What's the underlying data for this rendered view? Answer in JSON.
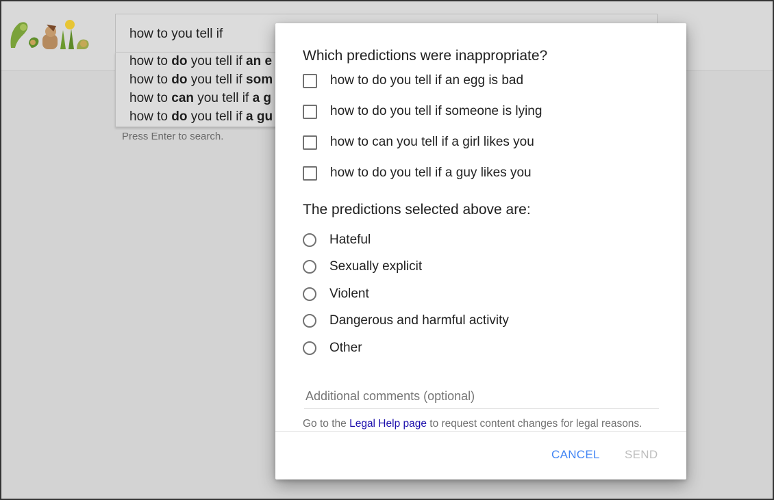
{
  "search": {
    "query": "how to you tell if",
    "press_enter_hint": "Press Enter to search.",
    "suggestions": [
      {
        "pre": "how to ",
        "bold1": "do",
        "mid": " you tell if ",
        "bold2": "an e"
      },
      {
        "pre": "how to ",
        "bold1": "do",
        "mid": " you tell if ",
        "bold2": "som"
      },
      {
        "pre": "how to ",
        "bold1": "can",
        "mid": " you tell if ",
        "bold2": "a g"
      },
      {
        "pre": "how to ",
        "bold1": "do",
        "mid": " you tell if ",
        "bold2": "a gu"
      }
    ]
  },
  "dialog": {
    "question": "Which predictions were inappropriate?",
    "predictions": [
      {
        "label": "how to do you tell if an egg is bad",
        "checked": false
      },
      {
        "label": "how to do you tell if someone is lying",
        "checked": false
      },
      {
        "label": "how to can you tell if a girl likes you",
        "checked": false
      },
      {
        "label": "how to do you tell if a guy likes you",
        "checked": false
      }
    ],
    "category_title": "The predictions selected above are:",
    "categories": [
      {
        "label": "Hateful",
        "selected": false
      },
      {
        "label": "Sexually explicit",
        "selected": false
      },
      {
        "label": "Violent",
        "selected": false
      },
      {
        "label": "Dangerous and harmful activity",
        "selected": false
      },
      {
        "label": "Other",
        "selected": false
      }
    ],
    "comments_placeholder": "Additional comments (optional)",
    "legal": {
      "prefix": "Go to the ",
      "link_text": "Legal Help page",
      "suffix": " to request content changes for legal reasons."
    },
    "cancel_label": "CANCEL",
    "send_label": "SEND"
  },
  "colors": {
    "accent": "#4285f4",
    "link": "#1a0dab",
    "disabled": "#bdbdbd"
  }
}
